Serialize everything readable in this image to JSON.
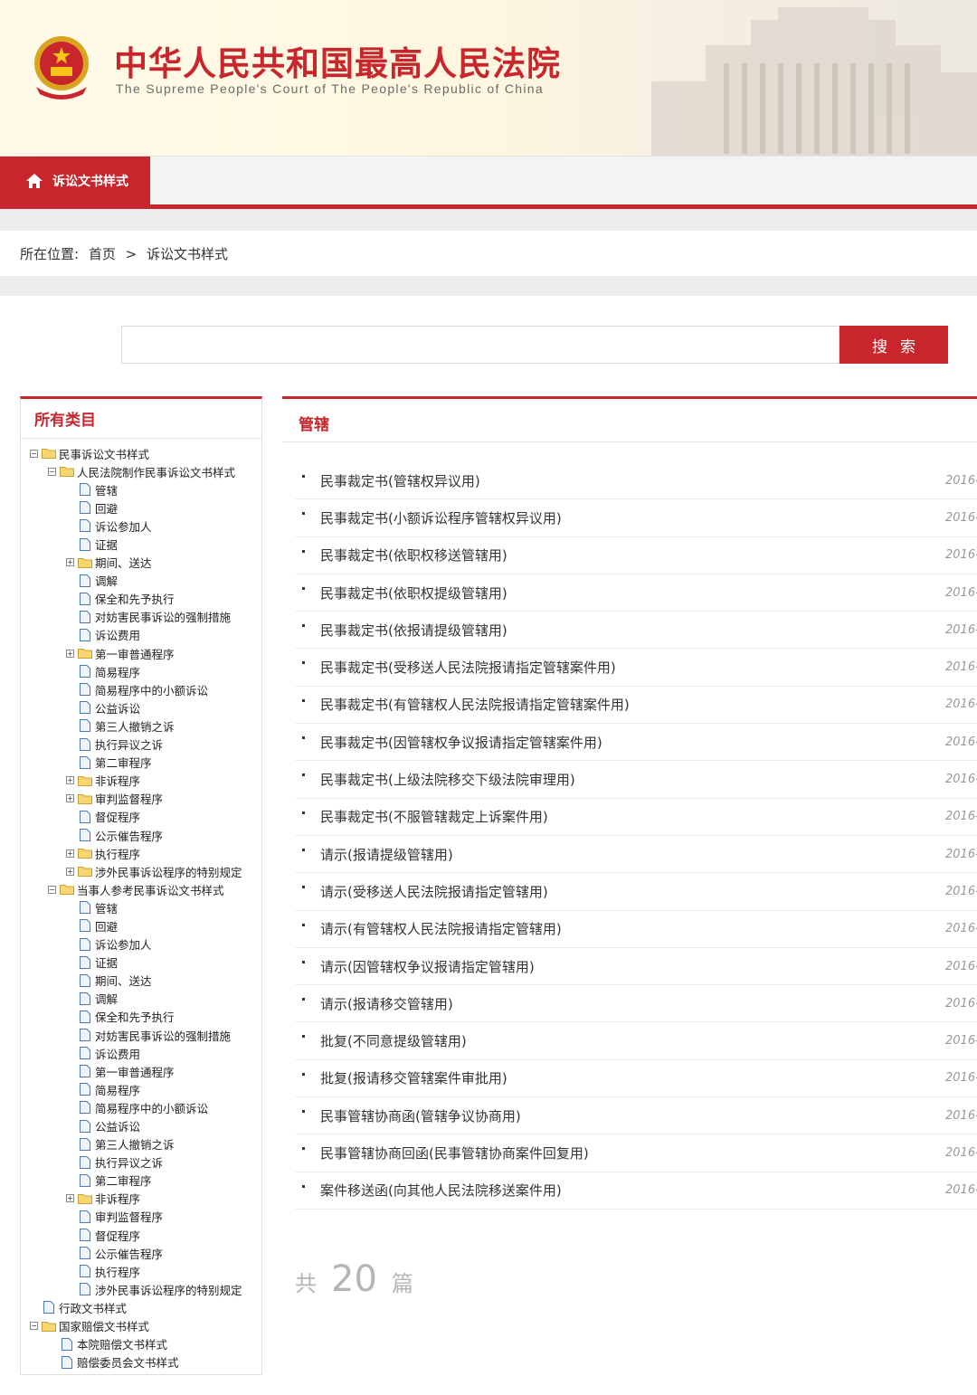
{
  "header": {
    "title": "中华人民共和国最高人民法院",
    "subtitle": "The Supreme People's Court of The People's Republic of China"
  },
  "nav": {
    "active_label": "诉讼文书样式"
  },
  "breadcrumb": {
    "prefix": "所在位置:",
    "home": "首页",
    "separator": ">",
    "current": "诉讼文书样式"
  },
  "search": {
    "value": "",
    "button_label": "搜索"
  },
  "sidebar": {
    "title": "所有类目",
    "tree": [
      {
        "depth": 0,
        "toggle": "minus",
        "type": "folder",
        "label": "民事诉讼文书样式"
      },
      {
        "depth": 1,
        "toggle": "minus",
        "type": "folder",
        "label": "人民法院制作民事诉讼文书样式"
      },
      {
        "depth": 2,
        "toggle": "",
        "type": "file",
        "label": "管辖"
      },
      {
        "depth": 2,
        "toggle": "",
        "type": "file",
        "label": "回避"
      },
      {
        "depth": 2,
        "toggle": "",
        "type": "file",
        "label": "诉讼参加人"
      },
      {
        "depth": 2,
        "toggle": "",
        "type": "file",
        "label": "证据"
      },
      {
        "depth": 2,
        "toggle": "plus",
        "type": "folder",
        "label": "期间、送达"
      },
      {
        "depth": 2,
        "toggle": "",
        "type": "file",
        "label": "调解"
      },
      {
        "depth": 2,
        "toggle": "",
        "type": "file",
        "label": "保全和先予执行"
      },
      {
        "depth": 2,
        "toggle": "",
        "type": "file",
        "label": "对妨害民事诉讼的强制措施"
      },
      {
        "depth": 2,
        "toggle": "",
        "type": "file",
        "label": "诉讼费用"
      },
      {
        "depth": 2,
        "toggle": "plus",
        "type": "folder",
        "label": "第一审普通程序"
      },
      {
        "depth": 2,
        "toggle": "",
        "type": "file",
        "label": "简易程序"
      },
      {
        "depth": 2,
        "toggle": "",
        "type": "file",
        "label": "简易程序中的小额诉讼"
      },
      {
        "depth": 2,
        "toggle": "",
        "type": "file",
        "label": "公益诉讼"
      },
      {
        "depth": 2,
        "toggle": "",
        "type": "file",
        "label": "第三人撤销之诉"
      },
      {
        "depth": 2,
        "toggle": "",
        "type": "file",
        "label": "执行异议之诉"
      },
      {
        "depth": 2,
        "toggle": "",
        "type": "file",
        "label": "第二审程序"
      },
      {
        "depth": 2,
        "toggle": "plus",
        "type": "folder",
        "label": "非诉程序"
      },
      {
        "depth": 2,
        "toggle": "plus",
        "type": "folder",
        "label": "审判监督程序"
      },
      {
        "depth": 2,
        "toggle": "",
        "type": "file",
        "label": "督促程序"
      },
      {
        "depth": 2,
        "toggle": "",
        "type": "file",
        "label": "公示催告程序"
      },
      {
        "depth": 2,
        "toggle": "plus",
        "type": "folder",
        "label": "执行程序"
      },
      {
        "depth": 2,
        "toggle": "plus",
        "type": "folder",
        "label": "涉外民事诉讼程序的特别规定"
      },
      {
        "depth": 1,
        "toggle": "minus",
        "type": "folder",
        "label": "当事人参考民事诉讼文书样式"
      },
      {
        "depth": 2,
        "toggle": "",
        "type": "file",
        "label": "管辖"
      },
      {
        "depth": 2,
        "toggle": "",
        "type": "file",
        "label": "回避"
      },
      {
        "depth": 2,
        "toggle": "",
        "type": "file",
        "label": "诉讼参加人"
      },
      {
        "depth": 2,
        "toggle": "",
        "type": "file",
        "label": "证据"
      },
      {
        "depth": 2,
        "toggle": "",
        "type": "file",
        "label": "期间、送达"
      },
      {
        "depth": 2,
        "toggle": "",
        "type": "file",
        "label": "调解"
      },
      {
        "depth": 2,
        "toggle": "",
        "type": "file",
        "label": "保全和先予执行"
      },
      {
        "depth": 2,
        "toggle": "",
        "type": "file",
        "label": "对妨害民事诉讼的强制措施"
      },
      {
        "depth": 2,
        "toggle": "",
        "type": "file",
        "label": "诉讼费用"
      },
      {
        "depth": 2,
        "toggle": "",
        "type": "file",
        "label": "第一审普通程序"
      },
      {
        "depth": 2,
        "toggle": "",
        "type": "file",
        "label": "简易程序"
      },
      {
        "depth": 2,
        "toggle": "",
        "type": "file",
        "label": "简易程序中的小额诉讼"
      },
      {
        "depth": 2,
        "toggle": "",
        "type": "file",
        "label": "公益诉讼"
      },
      {
        "depth": 2,
        "toggle": "",
        "type": "file",
        "label": "第三人撤销之诉"
      },
      {
        "depth": 2,
        "toggle": "",
        "type": "file",
        "label": "执行异议之诉"
      },
      {
        "depth": 2,
        "toggle": "",
        "type": "file",
        "label": "第二审程序"
      },
      {
        "depth": 2,
        "toggle": "plus",
        "type": "folder",
        "label": "非诉程序"
      },
      {
        "depth": 2,
        "toggle": "",
        "type": "file",
        "label": "审判监督程序"
      },
      {
        "depth": 2,
        "toggle": "",
        "type": "file",
        "label": "督促程序"
      },
      {
        "depth": 2,
        "toggle": "",
        "type": "file",
        "label": "公示催告程序"
      },
      {
        "depth": 2,
        "toggle": "",
        "type": "file",
        "label": "执行程序"
      },
      {
        "depth": 2,
        "toggle": "",
        "type": "file",
        "label": "涉外民事诉讼程序的特别规定"
      },
      {
        "depth": 0,
        "toggle": "",
        "type": "file",
        "label": "行政文书样式"
      },
      {
        "depth": 0,
        "toggle": "minus",
        "type": "folder",
        "label": "国家赔偿文书样式"
      },
      {
        "depth": 1,
        "toggle": "",
        "type": "file",
        "label": "本院赔偿文书样式"
      },
      {
        "depth": 1,
        "toggle": "",
        "type": "file",
        "label": "赔偿委员会文书样式"
      }
    ]
  },
  "main": {
    "title": "管辖",
    "docs": [
      {
        "title": "民事裁定书(管辖权异议用)",
        "date": "2016-"
      },
      {
        "title": "民事裁定书(小额诉讼程序管辖权异议用)",
        "date": "2016-"
      },
      {
        "title": "民事裁定书(依职权移送管辖用)",
        "date": "2016-"
      },
      {
        "title": "民事裁定书(依职权提级管辖用)",
        "date": "2016-"
      },
      {
        "title": "民事裁定书(依报请提级管辖用)",
        "date": "2016-"
      },
      {
        "title": "民事裁定书(受移送人民法院报请指定管辖案件用)",
        "date": "2016-"
      },
      {
        "title": "民事裁定书(有管辖权人民法院报请指定管辖案件用)",
        "date": "2016-"
      },
      {
        "title": "民事裁定书(因管辖权争议报请指定管辖案件用)",
        "date": "2016-"
      },
      {
        "title": "民事裁定书(上级法院移交下级法院审理用)",
        "date": "2016-"
      },
      {
        "title": "民事裁定书(不服管辖裁定上诉案件用)",
        "date": "2016-"
      },
      {
        "title": "请示(报请提级管辖用)",
        "date": "2016-"
      },
      {
        "title": "请示(受移送人民法院报请指定管辖用)",
        "date": "2016-"
      },
      {
        "title": "请示(有管辖权人民法院报请指定管辖用)",
        "date": "2016-"
      },
      {
        "title": "请示(因管辖权争议报请指定管辖用)",
        "date": "2016-"
      },
      {
        "title": "请示(报请移交管辖用)",
        "date": "2016-"
      },
      {
        "title": "批复(不同意提级管辖用)",
        "date": "2016-"
      },
      {
        "title": "批复(报请移交管辖案件审批用)",
        "date": "2016-"
      },
      {
        "title": "民事管辖协商函(管辖争议协商用)",
        "date": "2016-"
      },
      {
        "title": "民事管辖协商回函(民事管辖协商案件回复用)",
        "date": "2016-"
      },
      {
        "title": "案件移送函(向其他人民法院移送案件用)",
        "date": "2016-"
      }
    ],
    "total": {
      "prefix": "共",
      "count": "20",
      "suffix": "篇"
    }
  },
  "colors": {
    "accent": "#c8262c"
  }
}
